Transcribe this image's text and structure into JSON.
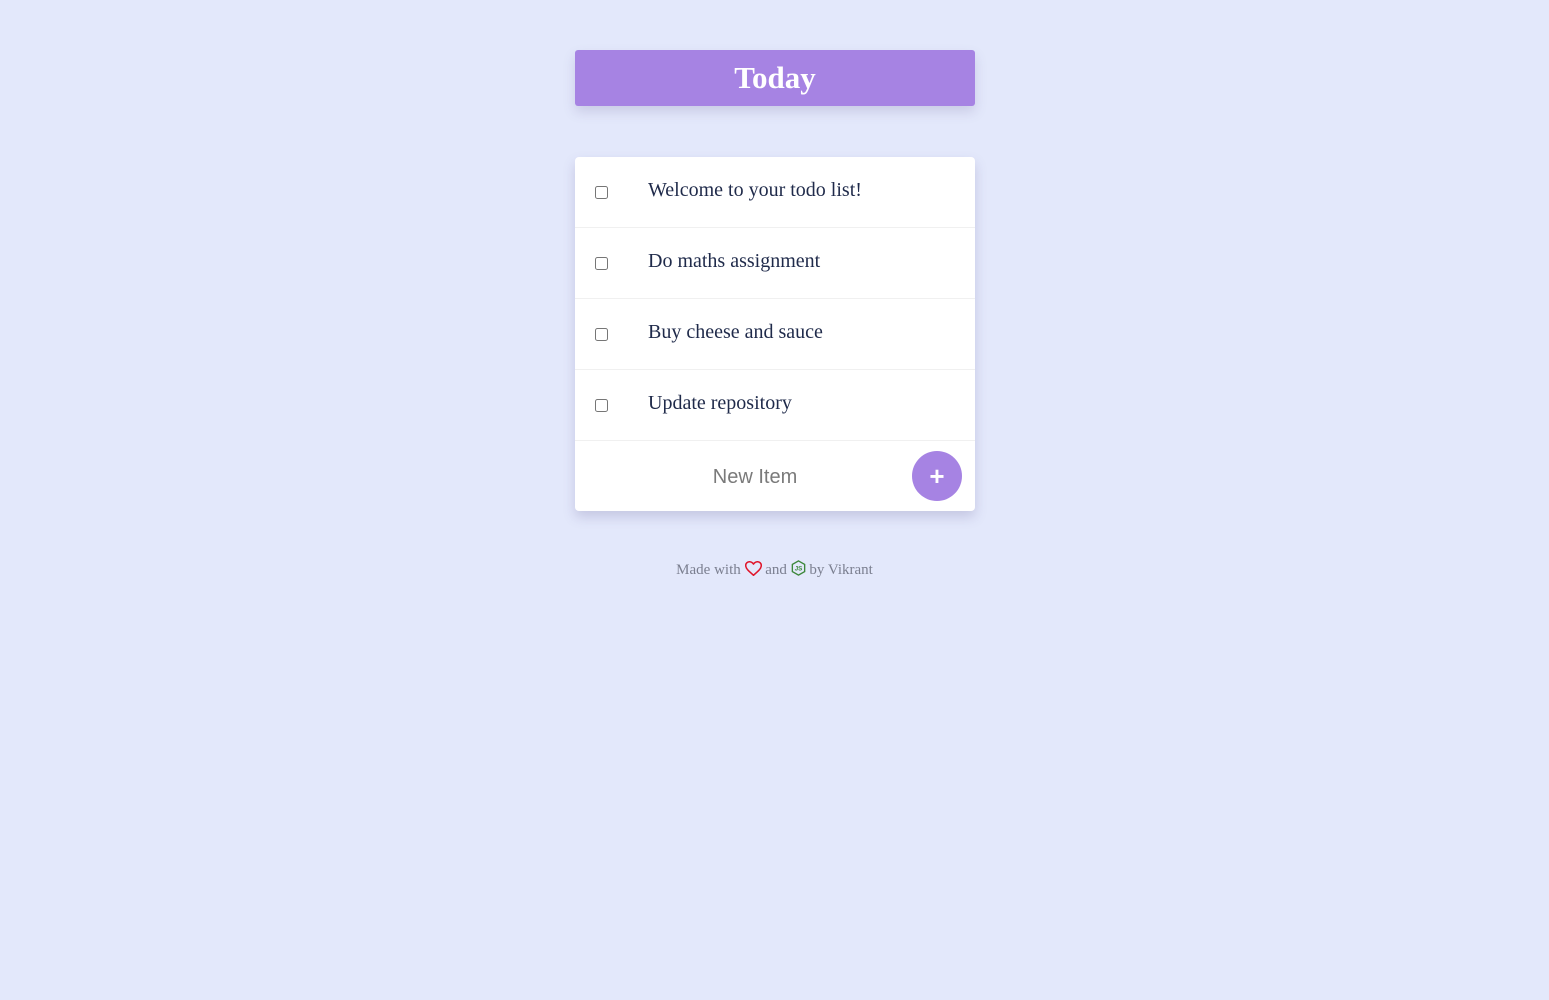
{
  "header": {
    "title": "Today"
  },
  "todo_items": [
    {
      "label": "Welcome to your todo list!",
      "checked": false
    },
    {
      "label": "Do maths assignment",
      "checked": false
    },
    {
      "label": "Buy cheese and sauce",
      "checked": false
    },
    {
      "label": "Update repository",
      "checked": false
    }
  ],
  "new_item": {
    "placeholder": "New Item",
    "value": "",
    "add_label": "+"
  },
  "footer": {
    "made_with": "Made with",
    "and": "and",
    "by": "by Vikrant",
    "heart_icon": "heart-icon",
    "js_icon": "nodejs-icon"
  },
  "colors": {
    "background": "#e3e8fb",
    "accent": "#a683e3",
    "heart": "#e0162b",
    "node_green": "#3c873a"
  }
}
